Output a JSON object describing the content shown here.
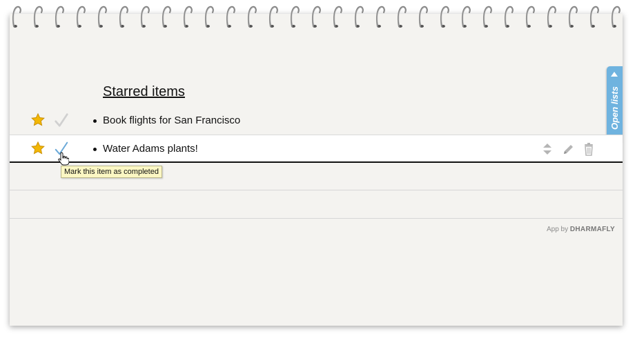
{
  "spiral": {
    "icon": "spiral-binding"
  },
  "side_tab": {
    "label": "Open lists",
    "icon": "triangle-up-icon",
    "color": "#6fb3df"
  },
  "list": {
    "title": "Starred items",
    "items": [
      {
        "text": "Book flights for San Francisco",
        "starred": true,
        "completed": false
      },
      {
        "text": "Water Adams plants!",
        "starred": true,
        "completed": false,
        "hovered": true
      }
    ]
  },
  "tooltip": {
    "text": "Mark this item as completed"
  },
  "footer": {
    "prefix": "App by",
    "brand": "DHARMAFLY"
  },
  "colors": {
    "star": "#f2b705",
    "check_idle": "#cfcfcf",
    "check_hover": "#6aa9d8",
    "paper": "#f4f3f0"
  }
}
